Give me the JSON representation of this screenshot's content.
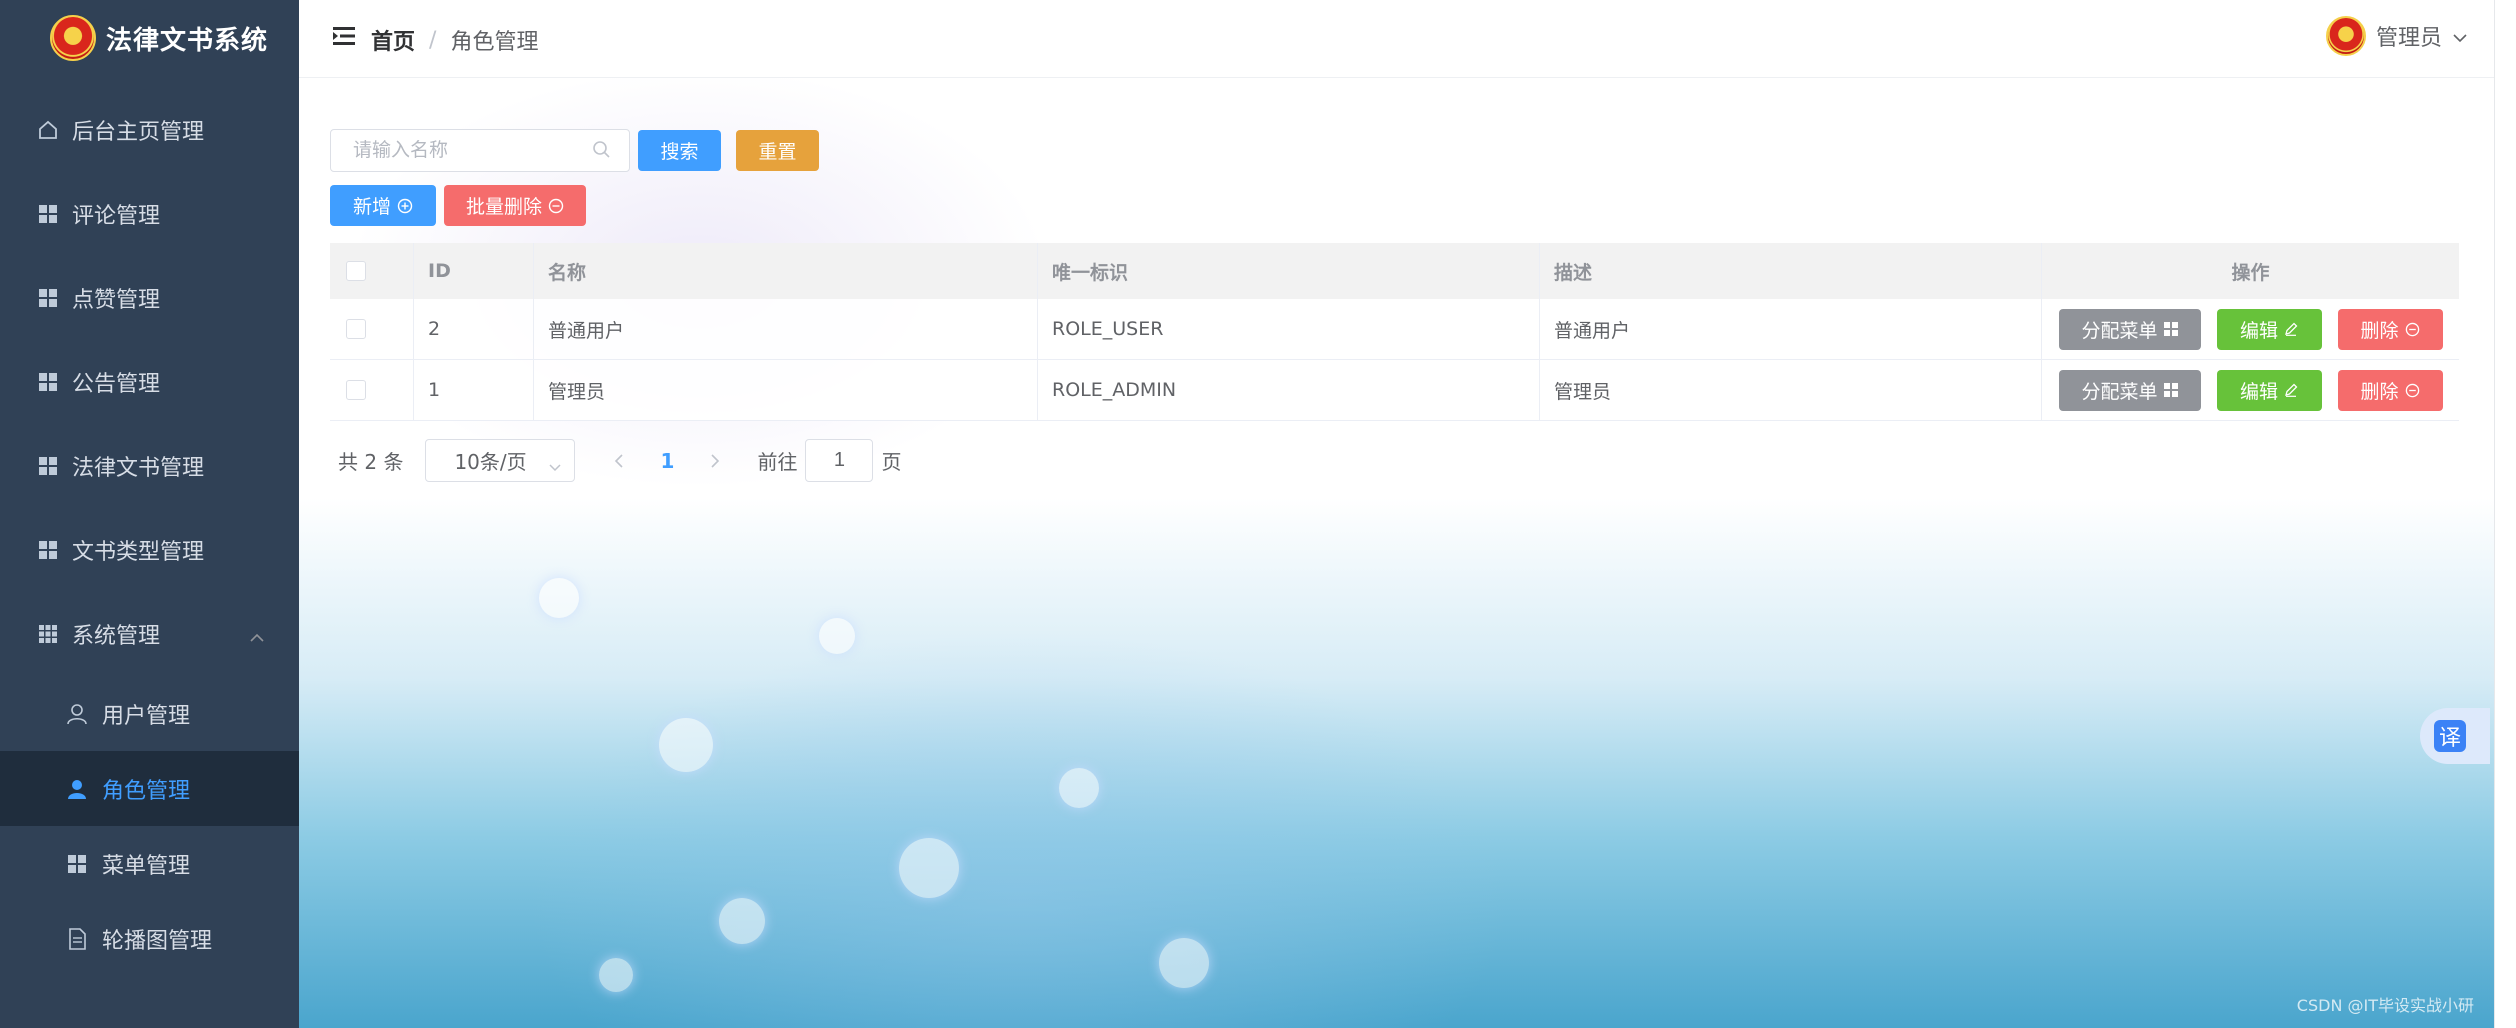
{
  "app": {
    "title": "法律文书系统"
  },
  "sidebar": {
    "items": [
      {
        "label": "后台主页管理"
      },
      {
        "label": "评论管理"
      },
      {
        "label": "点赞管理"
      },
      {
        "label": "公告管理"
      },
      {
        "label": "法律文书管理"
      },
      {
        "label": "文书类型管理"
      },
      {
        "label": "系统管理"
      }
    ],
    "sub_items": [
      {
        "label": "用户管理"
      },
      {
        "label": "角色管理",
        "active": true
      },
      {
        "label": "菜单管理"
      },
      {
        "label": "轮播图管理"
      }
    ]
  },
  "header": {
    "breadcrumb_home": "首页",
    "breadcrumb_sep": "/",
    "breadcrumb_current": "角色管理",
    "user_name": "管理员"
  },
  "toolbar": {
    "search_placeholder": "请输入名称",
    "search_label": "搜索",
    "reset_label": "重置",
    "add_label": "新增",
    "batch_delete_label": "批量删除"
  },
  "table": {
    "columns": [
      "ID",
      "名称",
      "唯一标识",
      "描述",
      "操作"
    ],
    "rows": [
      {
        "id": "2",
        "name": "普通用户",
        "code": "ROLE_USER",
        "desc": "普通用户"
      },
      {
        "id": "1",
        "name": "管理员",
        "code": "ROLE_ADMIN",
        "desc": "管理员"
      }
    ],
    "actions": {
      "assign_menu": "分配菜单",
      "edit": "编辑",
      "delete": "删除"
    }
  },
  "pagination": {
    "total_text": "共 2 条",
    "page_size": "10条/页",
    "current_page": "1",
    "goto_label": "前往",
    "goto_value": "1",
    "page_suffix": "页"
  },
  "translate_badge": "译",
  "watermark": "CSDN @IT毕设实战小研",
  "colors": {
    "sidebar_bg": "#304156",
    "primary": "#409eff",
    "warning": "#e6a23c",
    "danger": "#f56c6c",
    "success": "#67c23a",
    "info": "#909399"
  },
  "icons": [
    "hamburger-icon",
    "home-icon",
    "grid-icon",
    "apps-icon",
    "chevron-up-icon",
    "user-icon",
    "document-icon",
    "search-icon",
    "plus-circle-icon",
    "minus-circle-icon",
    "edit-icon",
    "chevron-down-icon",
    "chevron-left-icon",
    "chevron-right-icon"
  ]
}
